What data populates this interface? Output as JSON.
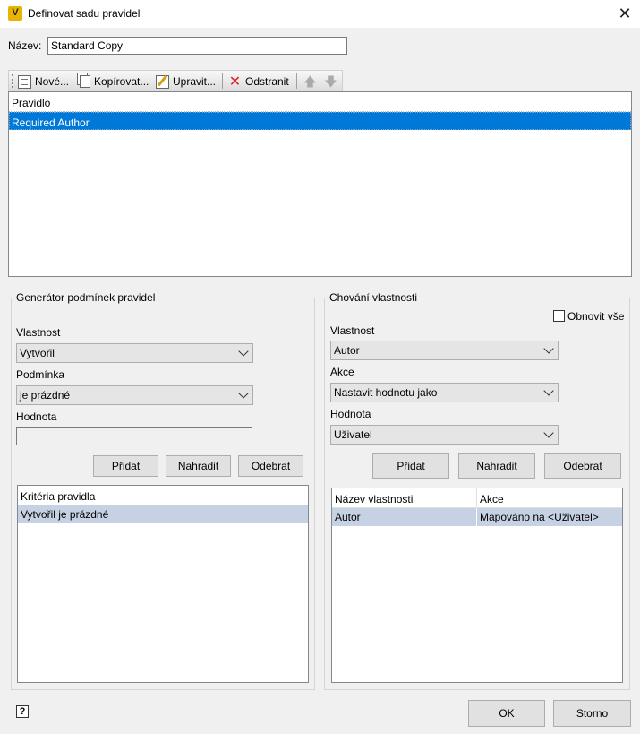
{
  "window": {
    "title": "Definovat sadu pravidel",
    "app_icon_letter": "V"
  },
  "name_field": {
    "label": "Název:",
    "value": "Standard Copy"
  },
  "toolbar": {
    "new_label": "Nové...",
    "copy_label": "Kopírovat...",
    "edit_label": "Upravit...",
    "delete_label": "Odstranit"
  },
  "rules_list": {
    "header": "Pravidlo",
    "rows": [
      "Required Author"
    ]
  },
  "condition_builder": {
    "title": "Generátor podmínek pravidel",
    "property_label": "Vlastnost",
    "property_value": "Vytvořil",
    "condition_label": "Podmínka",
    "condition_value": "je prázdné",
    "value_label": "Hodnota",
    "value_value": "",
    "add_label": "Přidat",
    "replace_label": "Nahradit",
    "remove_label": "Odebrat",
    "criteria_header": "Kritéria pravidla",
    "criteria_rows": [
      "Vytvořil je prázdné"
    ]
  },
  "property_behavior": {
    "title": "Chování vlastnosti",
    "refresh_all_label": "Obnovit vše",
    "property_label": "Vlastnost",
    "property_value": "Autor",
    "action_label": "Akce",
    "action_value": "Nastavit hodnotu jako",
    "value_label": "Hodnota",
    "value_value": "Uživatel",
    "add_label": "Přidat",
    "replace_label": "Nahradit",
    "remove_label": "Odebrat",
    "table_headers": [
      "Název vlastnosti",
      "Akce"
    ],
    "table_rows": [
      [
        "Autor",
        "Mapováno na <Uživatel>"
      ]
    ]
  },
  "footer": {
    "ok_label": "OK",
    "cancel_label": "Storno",
    "help_glyph": "?"
  },
  "colors": {
    "selection": "#0078d7",
    "row_highlight": "#c6d2e3",
    "background": "#f0f0f0"
  }
}
